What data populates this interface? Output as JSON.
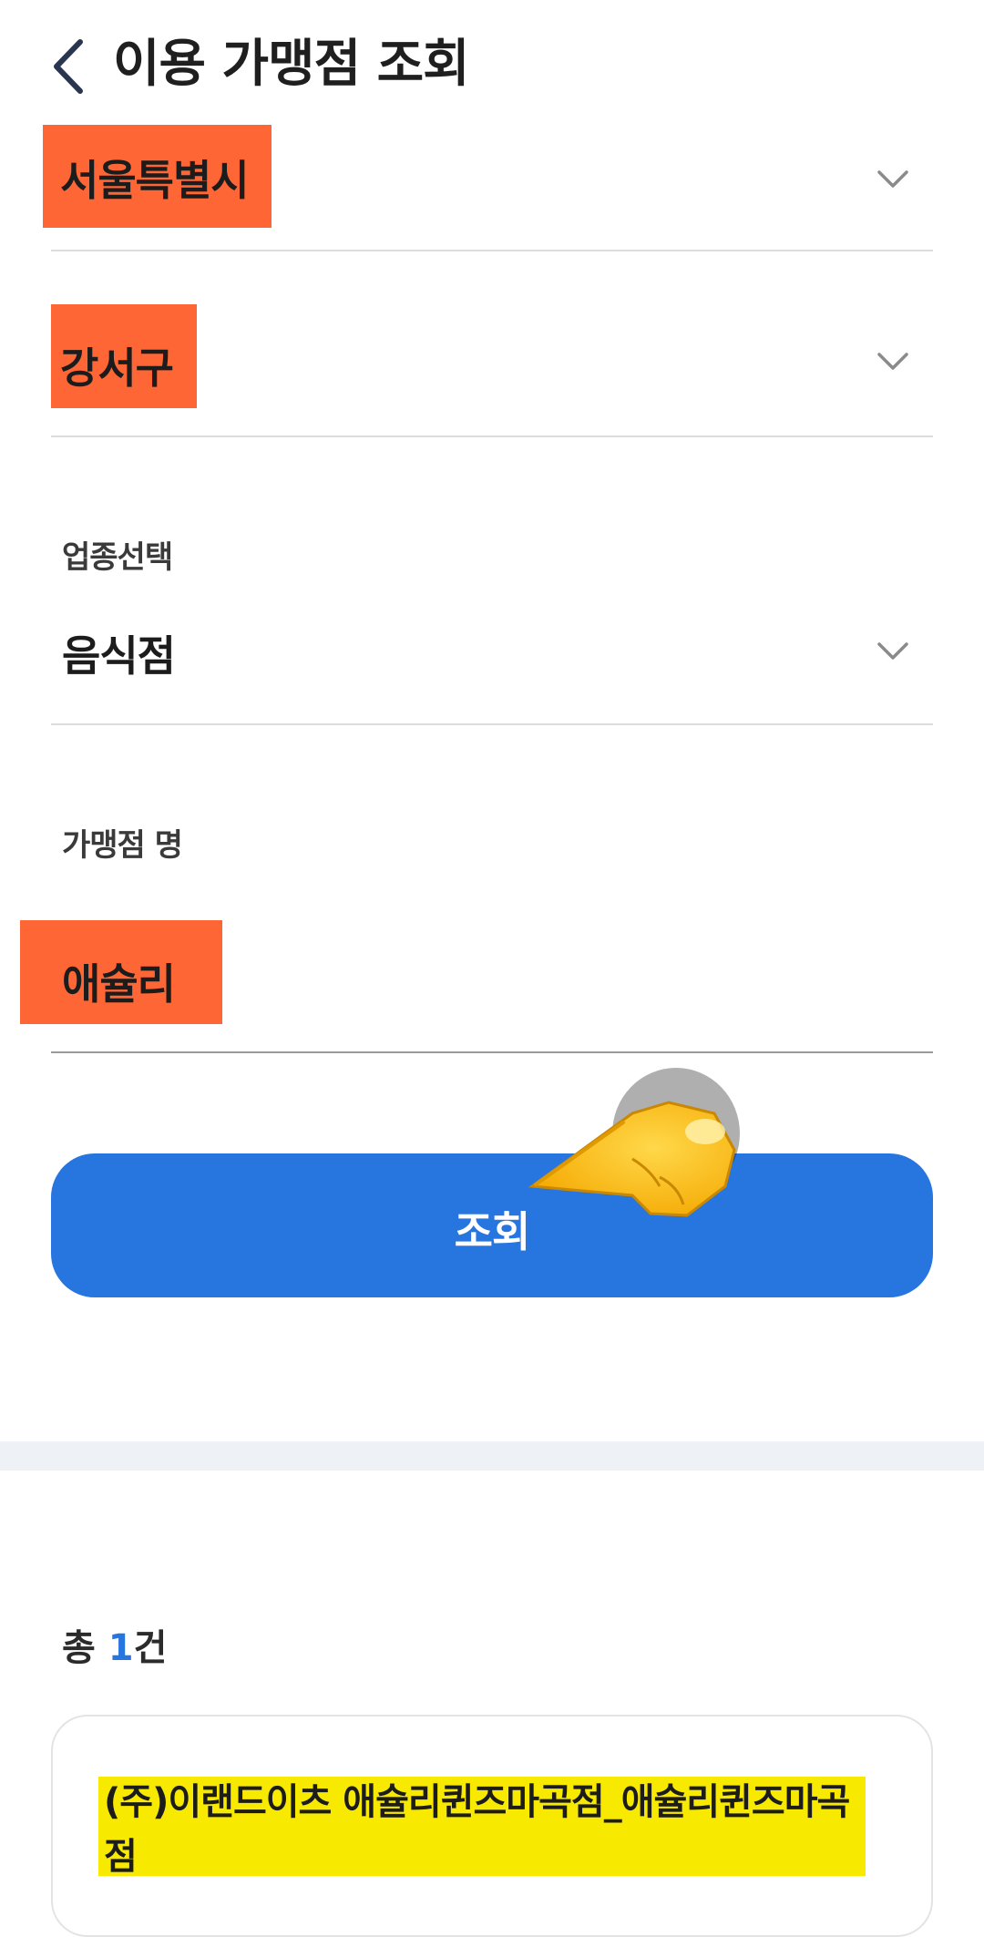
{
  "header": {
    "title": "이용 가맹점 조회"
  },
  "filters": {
    "city": {
      "value": "서울특별시"
    },
    "district": {
      "value": "강서구"
    },
    "business_type": {
      "label": "업종선택",
      "value": "음식점"
    },
    "merchant_name": {
      "label": "가맹점 명",
      "value": "애슐리"
    }
  },
  "search_button": {
    "label": "조회"
  },
  "results": {
    "count_prefix": "총 ",
    "count_value": "1",
    "count_suffix": "건",
    "items": [
      {
        "name": "(주)이랜드이츠 애슐리퀸즈마곡점_애슐리퀸즈마곡점"
      }
    ]
  },
  "colors": {
    "accent": "#2775df",
    "annotation_box": "#ff6635",
    "result_highlight": "#f7ea00"
  },
  "icons": {
    "back": "chevron-left-icon",
    "dropdown": "chevron-down-icon",
    "pointer": "pointing-hand-icon"
  }
}
